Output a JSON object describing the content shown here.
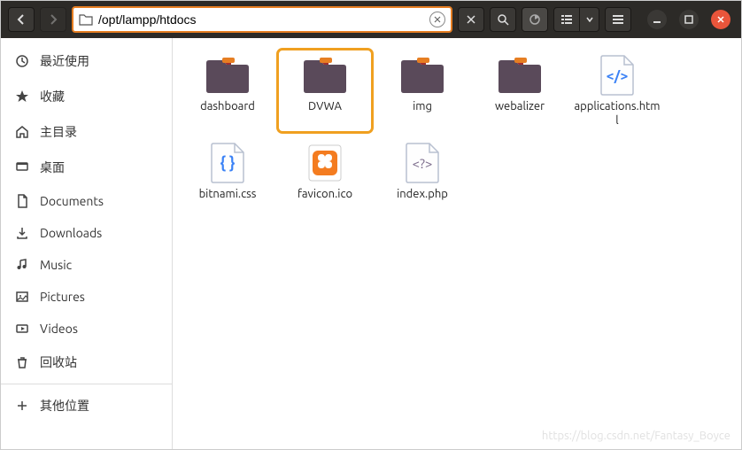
{
  "path": "/opt/lampp/htdocs",
  "sidebar": {
    "items": [
      {
        "label": "最近使用",
        "icon": "clock"
      },
      {
        "label": "收藏",
        "icon": "star"
      },
      {
        "label": "主目录",
        "icon": "home"
      },
      {
        "label": "桌面",
        "icon": "desktop"
      },
      {
        "label": "Documents",
        "icon": "document"
      },
      {
        "label": "Downloads",
        "icon": "download"
      },
      {
        "label": "Music",
        "icon": "music"
      },
      {
        "label": "Pictures",
        "icon": "picture"
      },
      {
        "label": "Videos",
        "icon": "video"
      },
      {
        "label": "回收站",
        "icon": "trash"
      }
    ],
    "other": {
      "label": "其他位置"
    }
  },
  "files": [
    {
      "name": "dashboard",
      "type": "folder",
      "selected": false
    },
    {
      "name": "DVWA",
      "type": "folder",
      "selected": true
    },
    {
      "name": "img",
      "type": "folder",
      "selected": false
    },
    {
      "name": "webalizer",
      "type": "folder",
      "selected": false
    },
    {
      "name": "applications.html",
      "type": "html",
      "selected": false
    },
    {
      "name": "bitnami.css",
      "type": "css",
      "selected": false
    },
    {
      "name": "favicon.ico",
      "type": "ico",
      "selected": false
    },
    {
      "name": "index.php",
      "type": "php",
      "selected": false
    }
  ],
  "watermark": "https://blog.csdn.net/Fantasy_Boyce"
}
